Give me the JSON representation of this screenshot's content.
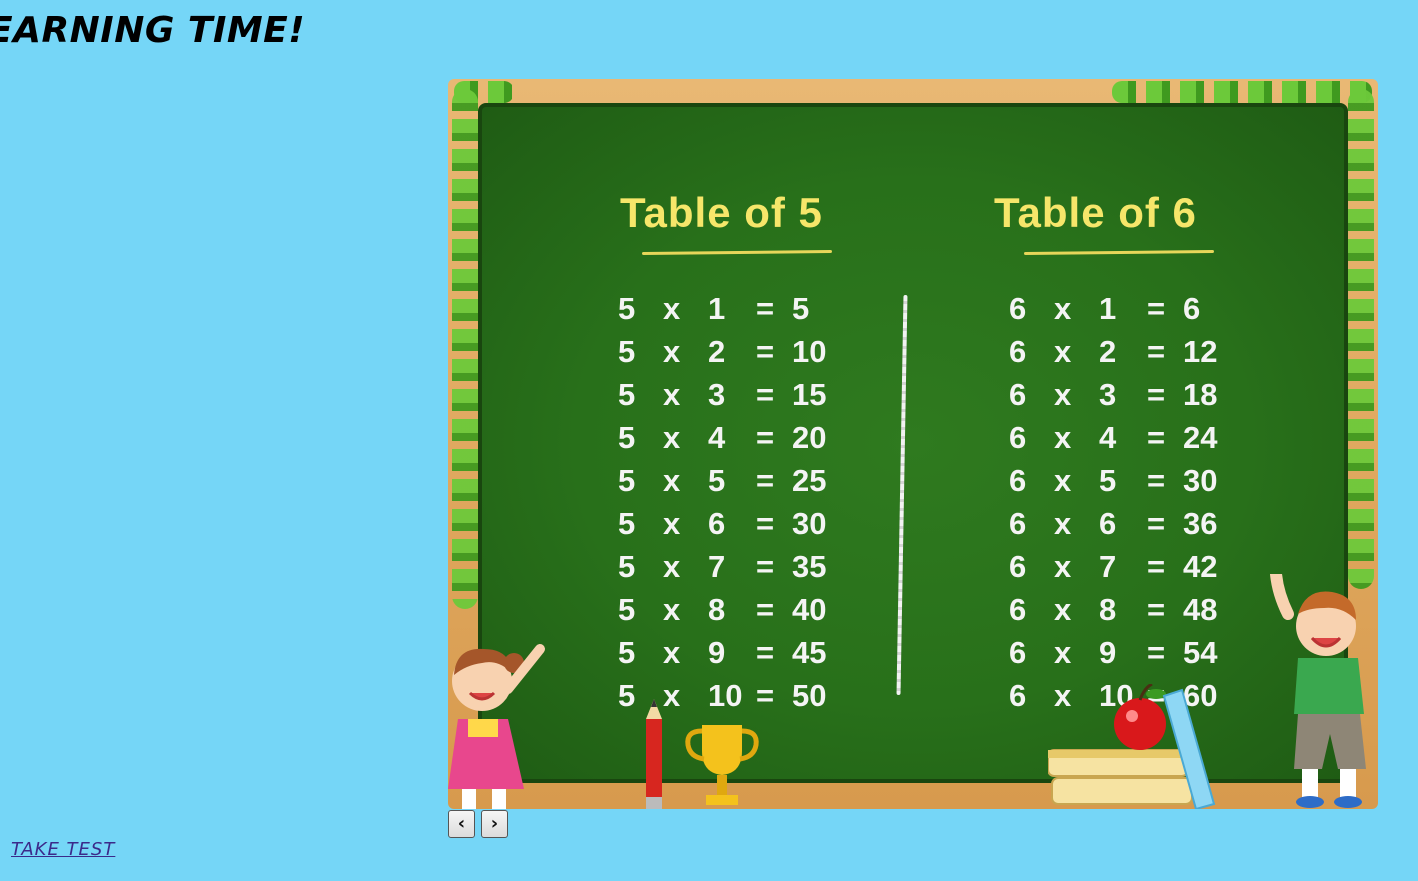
{
  "page": {
    "heading": "EARNING TIME!",
    "take_test_label": "TAKE TEST"
  },
  "slideshow": {
    "prev_label": "‹",
    "next_label": "›"
  },
  "slide": {
    "tables": [
      {
        "title": "Table of 5",
        "rows": [
          {
            "a": "5",
            "op": "x",
            "b": "1",
            "eq": "=",
            "r": "5"
          },
          {
            "a": "5",
            "op": "x",
            "b": "2",
            "eq": "=",
            "r": "10"
          },
          {
            "a": "5",
            "op": "x",
            "b": "3",
            "eq": "=",
            "r": "15"
          },
          {
            "a": "5",
            "op": "x",
            "b": "4",
            "eq": "=",
            "r": "20"
          },
          {
            "a": "5",
            "op": "x",
            "b": "5",
            "eq": "=",
            "r": "25"
          },
          {
            "a": "5",
            "op": "x",
            "b": "6",
            "eq": "=",
            "r": "30"
          },
          {
            "a": "5",
            "op": "x",
            "b": "7",
            "eq": "=",
            "r": "35"
          },
          {
            "a": "5",
            "op": "x",
            "b": "8",
            "eq": "=",
            "r": "40"
          },
          {
            "a": "5",
            "op": "x",
            "b": "9",
            "eq": "=",
            "r": "45"
          },
          {
            "a": "5",
            "op": "x",
            "b": "10",
            "eq": "=",
            "r": "50"
          }
        ]
      },
      {
        "title": "Table of 6",
        "rows": [
          {
            "a": "6",
            "op": "x",
            "b": "1",
            "eq": "=",
            "r": "6"
          },
          {
            "a": "6",
            "op": "x",
            "b": "2",
            "eq": "=",
            "r": "12"
          },
          {
            "a": "6",
            "op": "x",
            "b": "3",
            "eq": "=",
            "r": "18"
          },
          {
            "a": "6",
            "op": "x",
            "b": "4",
            "eq": "=",
            "r": "24"
          },
          {
            "a": "6",
            "op": "x",
            "b": "5",
            "eq": "=",
            "r": "30"
          },
          {
            "a": "6",
            "op": "x",
            "b": "6",
            "eq": "=",
            "r": "36"
          },
          {
            "a": "6",
            "op": "x",
            "b": "7",
            "eq": "=",
            "r": "42"
          },
          {
            "a": "6",
            "op": "x",
            "b": "8",
            "eq": "=",
            "r": "48"
          },
          {
            "a": "6",
            "op": "x",
            "b": "9",
            "eq": "=",
            "r": "54"
          },
          {
            "a": "6",
            "op": "x",
            "b": "10",
            "eq": "=",
            "r": "60"
          }
        ]
      }
    ]
  },
  "colors": {
    "page_background": "#75d6f7",
    "board_green": "#2f7a1f",
    "title_yellow": "#f6e66a",
    "link": "#3b2a8a"
  }
}
